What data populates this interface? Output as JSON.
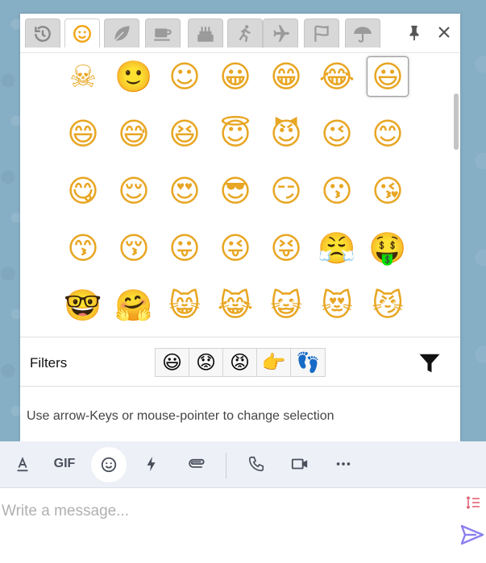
{
  "tabs": [
    {
      "name": "recent",
      "icon": "history-icon"
    },
    {
      "name": "smileys",
      "icon": "smiley-icon",
      "active": true
    },
    {
      "name": "nature",
      "icon": "leaf-icon"
    },
    {
      "name": "food",
      "icon": "coffee-cup-icon"
    },
    {
      "name": "celebration",
      "icon": "cake-icon"
    },
    {
      "name": "activity",
      "icon": "runner-icon"
    },
    {
      "name": "travel",
      "icon": "airplane-icon"
    },
    {
      "name": "flags",
      "icon": "flag-icon"
    },
    {
      "name": "symbols",
      "icon": "umbrella-icon"
    }
  ],
  "emoji_rows": [
    [
      "☠",
      "🙂",
      "☺",
      "😀",
      "😁",
      "😂",
      "😃"
    ],
    [
      "😄",
      "😅",
      "😆",
      "😇",
      "😈",
      "😉",
      "😊"
    ],
    [
      "😋",
      "😌",
      "😍",
      "😎",
      "😏",
      "😗",
      "😘"
    ],
    [
      "😙",
      "😚",
      "😛",
      "😜",
      "😝",
      "😤",
      "🤑"
    ],
    [
      "🤓",
      "🤗",
      "😸",
      "😹",
      "😺",
      "😻",
      "😼"
    ]
  ],
  "selected_emoji": "😃",
  "filters": {
    "label": "Filters",
    "options": [
      "😃",
      "😟",
      "😡",
      "👉",
      "👣"
    ]
  },
  "hint": "Use arrow-Keys or mouse-pointer to change selection",
  "toolbar": {
    "gif_label": "GIF",
    "items": [
      "text-format-icon",
      "gif",
      "emoji-icon",
      "lightning-icon",
      "paperclip-icon",
      "phone-icon",
      "video-camera-icon",
      "more-icon"
    ]
  },
  "composer": {
    "placeholder": "Write a message..."
  },
  "colors": {
    "accent": "#7b68ee",
    "toolbar_bg": "#eef0f8",
    "tab_bg": "#d8d8d8"
  }
}
